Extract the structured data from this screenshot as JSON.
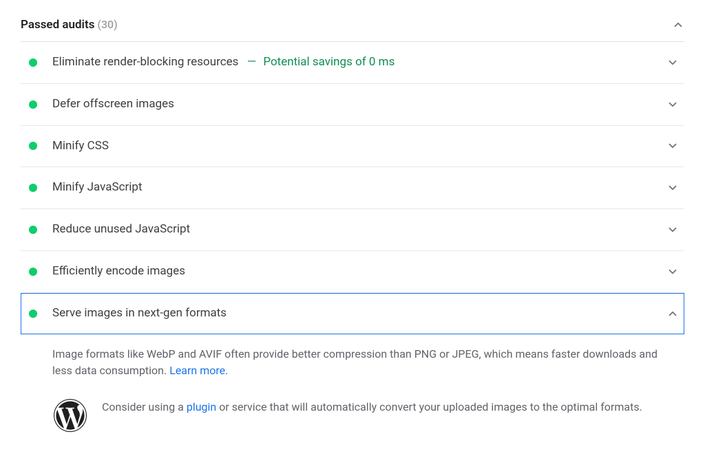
{
  "header": {
    "title": "Passed audits",
    "count": "(30)"
  },
  "audits": [
    {
      "label": "Eliminate render-blocking resources",
      "savings": "Potential savings of 0 ms",
      "expanded": false
    },
    {
      "label": "Defer offscreen images",
      "expanded": false
    },
    {
      "label": "Minify CSS",
      "expanded": false
    },
    {
      "label": "Minify JavaScript",
      "expanded": false
    },
    {
      "label": "Reduce unused JavaScript",
      "expanded": false
    },
    {
      "label": "Efficiently encode images",
      "expanded": false
    },
    {
      "label": "Serve images in next-gen formats",
      "expanded": true,
      "selected": true
    }
  ],
  "detail": {
    "text_1": "Image formats like WebP and AVIF often provide better compression than PNG or JPEG, which means faster downloads and less data consumption. ",
    "learn_more": "Learn more",
    "period": ".",
    "wp_text_1": "Consider using a ",
    "wp_link": "plugin",
    "wp_text_2": " or service that will automatically convert your uploaded images to the optimal formats."
  },
  "colors": {
    "pass_green": "#0dce6b",
    "savings_green": "#0d8f50",
    "link_blue": "#1a73e8",
    "focus_blue": "#1a73e8"
  }
}
